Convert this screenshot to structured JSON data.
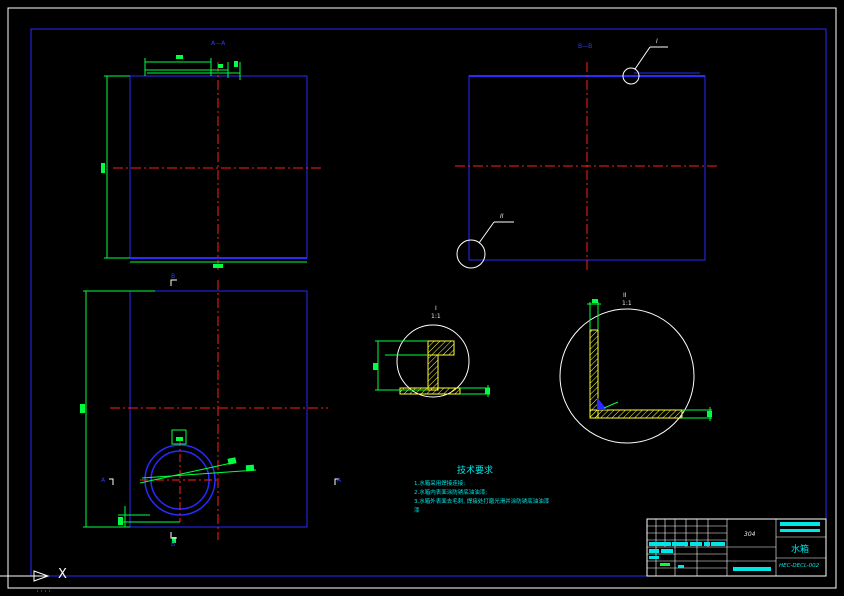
{
  "drawing": {
    "view_labels": {
      "section_aa": "A—A",
      "section_bb": "B—B",
      "detail_i_mark": "I",
      "detail_ii_mark": "II",
      "detail_i_title": "I",
      "detail_i_scale": "1:1",
      "detail_ii_title": "II",
      "detail_ii_scale": "1:1",
      "mark_a_left": "A",
      "mark_a_right": "A",
      "mark_b_top": "B",
      "mark_b_bottom": "B"
    },
    "tech_requirements": {
      "title": "技术要求",
      "lines": [
        "1.水箱采用焊接连接;",
        "2.水箱内表面涂防锈底油油漆;",
        "3.水箱外表面去毛刺, 焊接处打磨光滑并涂防锈底油油漆",
        "漆"
      ]
    },
    "title_block": {
      "material": "304",
      "part_name": "水箱",
      "drawing_no": "HEC-DECL-002"
    },
    "ucs_label": "X",
    "colors": {
      "background": "#000000",
      "frame": "#ffffff",
      "outline": "#2a2aff",
      "centerline": "#ff2020",
      "dimension": "#00ff40",
      "text": "#00e5e5",
      "white": "#ffffff"
    }
  }
}
